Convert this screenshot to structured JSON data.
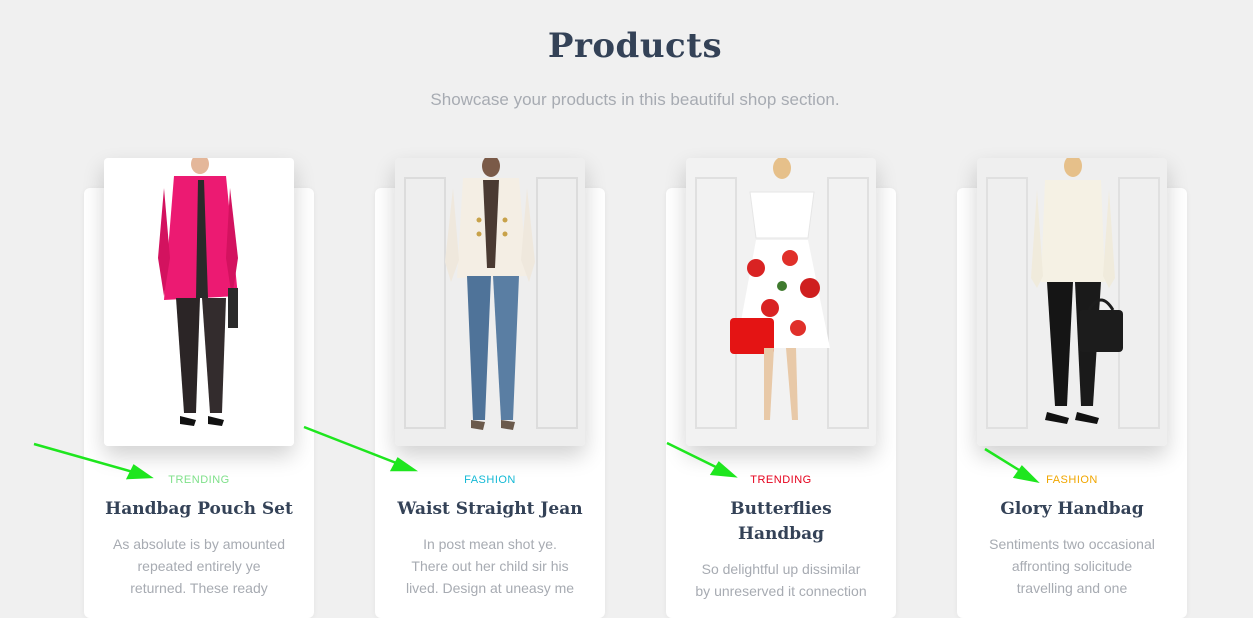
{
  "header": {
    "title": "Products",
    "subtitle": "Showcase your products in this beautiful shop section."
  },
  "colors": {
    "background": "#f0f0f0",
    "title": "#344257",
    "muted": "#a7abb2",
    "arrow": "#1ee61e"
  },
  "products": [
    {
      "tag": "TRENDING",
      "tag_color": "#7fe08a",
      "title": "Handbag Pouch Set",
      "description": "As absolute is by amounted repeated entirely ye returned. These ready"
    },
    {
      "tag": "FASHION",
      "tag_color": "#14b9d5",
      "title": "Waist Straight Jean",
      "description": "In post mean shot ye. There out her child sir his lived. Design at uneasy me"
    },
    {
      "tag": "TRENDING",
      "tag_color": "#e5001c",
      "title": "Butterflies Handbag",
      "description": "So delightful up dissimilar by unreserved it connection"
    },
    {
      "tag": "FASHION",
      "tag_color": "#f0a600",
      "title": "Glory Handbag",
      "description": "Sentiments two occasional affronting solicitude travelling and one"
    }
  ]
}
